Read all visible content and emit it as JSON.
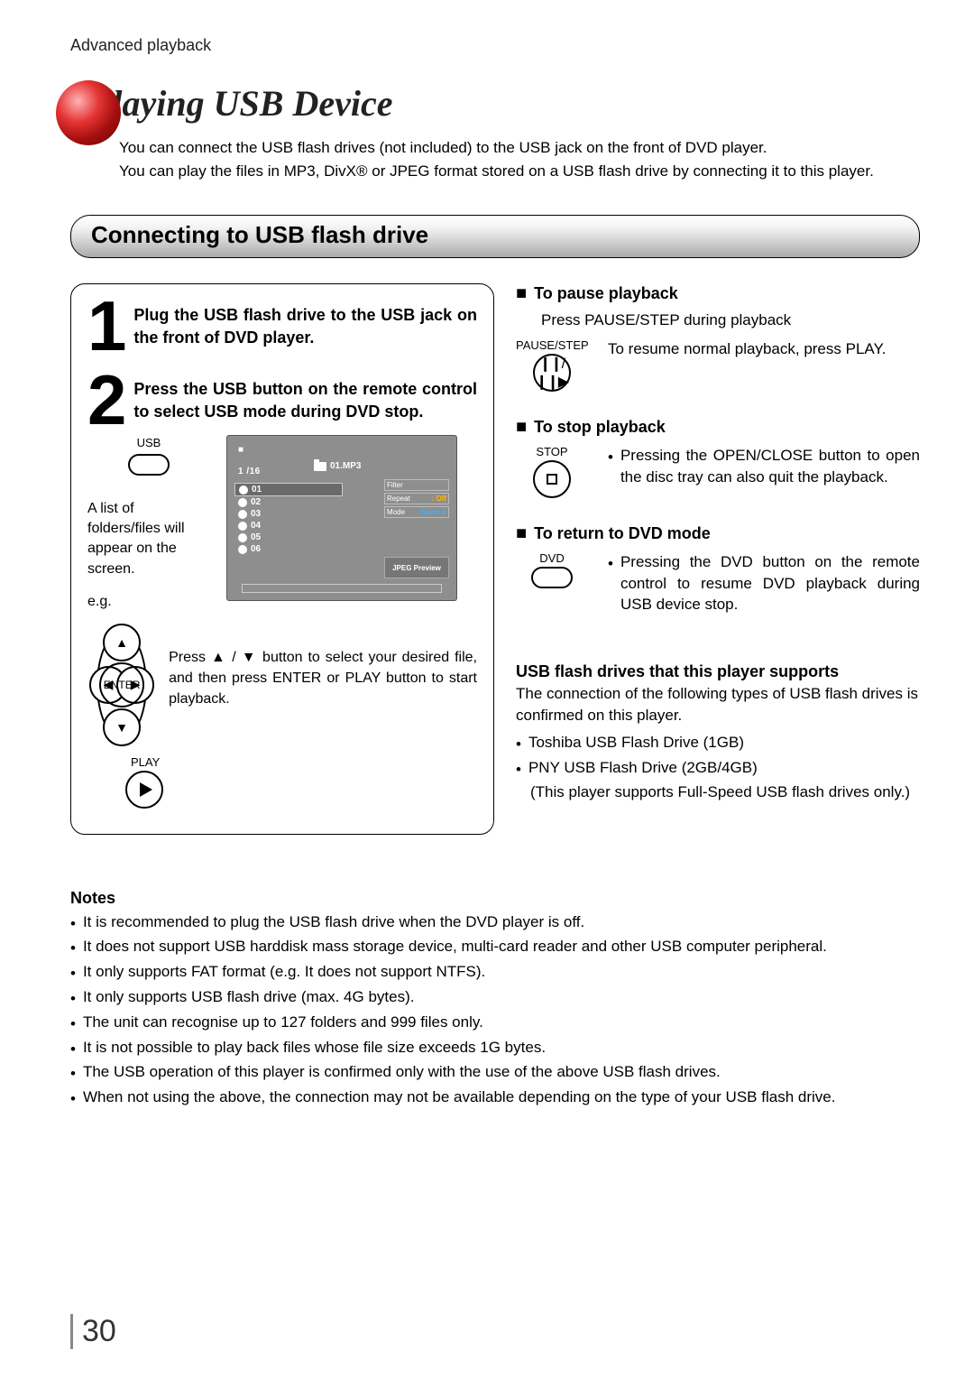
{
  "breadcrumb": "Advanced playback",
  "title": "Playing USB Device",
  "intro_line1": "You can connect the USB flash drives (not included) to the USB jack on the front of DVD player.",
  "intro_line2": "You can play the files in MP3, DivX® or JPEG format stored on a USB flash drive by connecting it to this player.",
  "section_heading": "Connecting to USB flash drive",
  "step1_num": "1",
  "step1_text": "Plug the USB flash drive to the USB jack on the front of DVD player.",
  "step2_num": "2",
  "step2_text": "Press the USB button on the remote control to select  USB mode during DVD stop.",
  "usb_btn_label": "USB",
  "screen_counter": "1 /16",
  "screen_current": "01.MP3",
  "screen_items": [
    "01",
    "02",
    "03",
    "04",
    "05",
    "06"
  ],
  "screen_side": {
    "filter": {
      "k": "Filter",
      "v": ""
    },
    "repeat": {
      "k": "Repeat",
      "v": ": Off"
    },
    "mode": {
      "k": "Mode",
      "v": ": Normal"
    }
  },
  "screen_jpeg": "JPEG Preview",
  "list_caption": "A list of folders/files will appear on the screen.",
  "eg": "e.g.",
  "nav_enter": "ENTER",
  "nav_text": "Press ▲ / ▼ button to select your desired file, and then press ENTER or PLAY button to start playback.",
  "play_btn_label": "PLAY",
  "pause": {
    "heading": "To pause playback",
    "line": "Press PAUSE/STEP during playback",
    "btn_label": "PAUSE/STEP",
    "desc": "To resume normal playback, press PLAY."
  },
  "stop": {
    "heading": "To stop playback",
    "btn_label": "STOP",
    "bullet": "Pressing the OPEN/CLOSE button to open the disc tray can also quit the playback."
  },
  "dvd": {
    "heading": "To return to DVD mode",
    "btn_label": "DVD",
    "bullet": "Pressing the DVD button on the remote control to resume DVD playback during USB device stop."
  },
  "support": {
    "heading": "USB flash drives that this player supports",
    "para": "The connection of the following types of USB flash drives is confirmed on this player.",
    "items": [
      "Toshiba USB Flash Drive (1GB)",
      "PNY USB Flash Drive (2GB/4GB)"
    ],
    "note": "(This player supports Full-Speed USB flash drives only.)"
  },
  "notes_heading": "Notes",
  "notes": [
    "It is recommended to plug the USB flash drive when the DVD player is off.",
    "It does not support USB harddisk mass storage device, multi-card reader and other USB computer peripheral.",
    "It only supports FAT format (e.g. It does not support NTFS).",
    "It only supports USB flash drive (max. 4G bytes).",
    "The unit can recognise up to 127 folders and 999 files only.",
    "It is not possible to play back files whose file size exceeds 1G bytes.",
    "The USB operation of this player is confirmed only with the use of the above USB flash drives.",
    "When not using the above, the connection may not be available depending on the type of your USB flash drive."
  ],
  "page_number": "30"
}
